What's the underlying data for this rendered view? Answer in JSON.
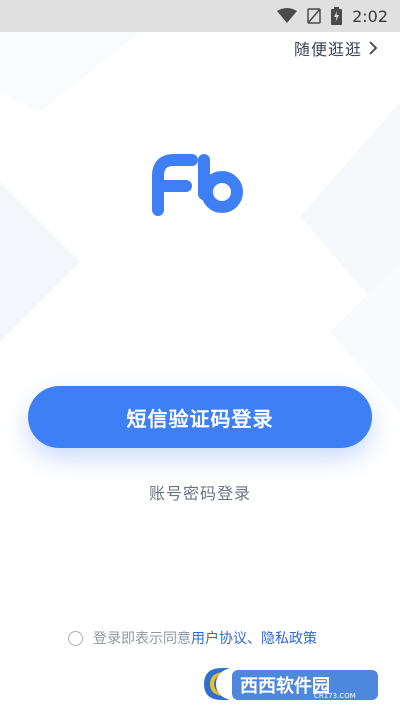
{
  "status_bar": {
    "time": "2:02",
    "icons": [
      "wifi-icon",
      "no-signal-icon",
      "battery-charging-icon"
    ]
  },
  "header": {
    "browse_label": "随便逛逛",
    "browse_icon": "chevron-right-icon"
  },
  "logo": {
    "icon": "fb-logo",
    "color": "#3f7ff6"
  },
  "actions": {
    "sms_login_label": "短信验证码登录",
    "password_login_label": "账号密码登录"
  },
  "agreement": {
    "prefix": "登录即表示同意",
    "user_agreement": "用户协议",
    "separator": "、",
    "privacy_policy": "隐私政策",
    "checked": false
  },
  "watermark": {
    "text": "西西软件园",
    "sub": "CR173.COM"
  },
  "colors": {
    "primary": "#3f7ff6",
    "link": "#3467d6",
    "status_bar": "#e0e0e0"
  }
}
